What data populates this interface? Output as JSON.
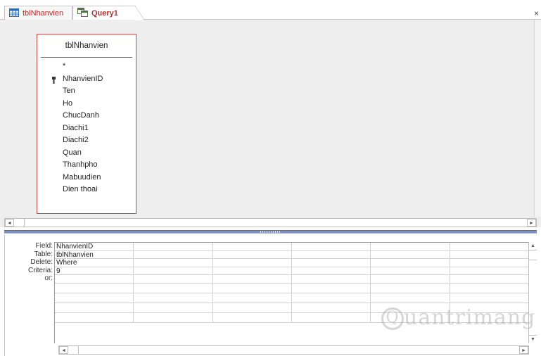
{
  "tabs": [
    {
      "label": "tblNhanvien",
      "icon": "table-icon",
      "active": false
    },
    {
      "label": "Query1",
      "icon": "query-icon",
      "active": true
    }
  ],
  "close_glyph": "×",
  "field_list": {
    "title": "tblNhanvien",
    "fields": [
      "*",
      "NhanvienID",
      "Ten",
      "Ho",
      "ChucDanh",
      "Diachi1",
      "Diachi2",
      "Quan",
      "Thanhpho",
      "Mabuudien",
      "Dien thoai"
    ],
    "primary_key": "NhanvienID"
  },
  "grid": {
    "row_labels": [
      "Field:",
      "Table:",
      "Delete:",
      "Criteria:",
      "or:"
    ],
    "columns": [
      {
        "field": "NhanvienID",
        "table": "tblNhanvien",
        "delete": "Where",
        "criteria": "9",
        "or": ""
      },
      {
        "field": "",
        "table": "",
        "delete": "",
        "criteria": "",
        "or": ""
      },
      {
        "field": "",
        "table": "",
        "delete": "",
        "criteria": "",
        "or": ""
      },
      {
        "field": "",
        "table": "",
        "delete": "",
        "criteria": "",
        "or": ""
      },
      {
        "field": "",
        "table": "",
        "delete": "",
        "criteria": "",
        "or": ""
      },
      {
        "field": "",
        "table": "",
        "delete": "",
        "criteria": "",
        "or": ""
      }
    ]
  },
  "scroll": {
    "left_glyph": "◄",
    "right_glyph": "►",
    "up_glyph": "▲",
    "down_glyph": "▼"
  },
  "watermark": {
    "text": "uantrimang",
    "initial": "Q"
  },
  "colors": {
    "tab_text": "#b22e2e",
    "field_list_border": "#c34a4a",
    "splitter": "#7f8fbf"
  }
}
